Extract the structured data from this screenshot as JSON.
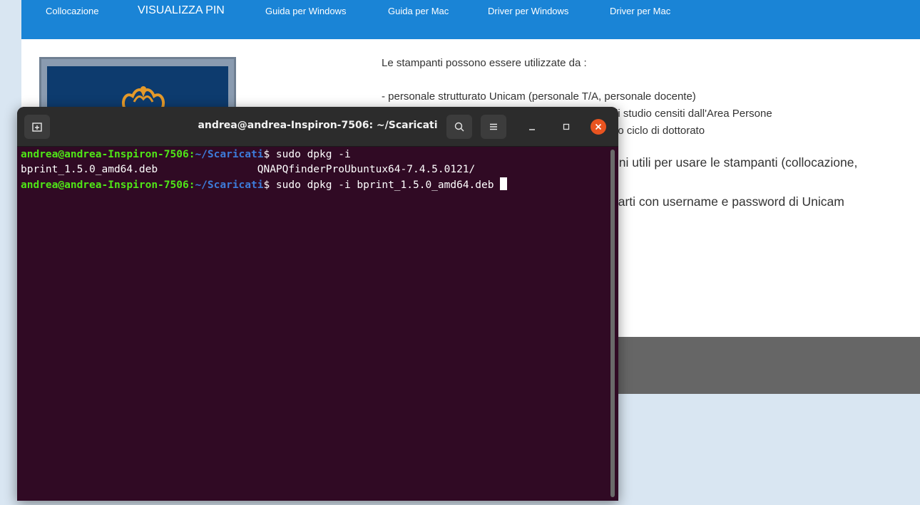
{
  "nav": {
    "items": [
      "Collocazione",
      "VISUALIZZA PIN",
      "Guida per Windows",
      "Guida per Mac",
      "Driver per Windows",
      "Driver per Mac"
    ]
  },
  "content": {
    "line1": "Le stampanti possono essere utilizzate da :",
    "line2": "- personale strutturato Unicam (personale T/A, personale docente)",
    "line3": "di studio censiti dall'Area Persone",
    "line4": "rio ciclo di dottorato",
    "line5": "oni utili per usare le stampanti (collocazione,",
    "line6": "carti con username e password di Unicam"
  },
  "terminal": {
    "title": "andrea@andrea-Inspiron-7506: ~/Scaricati",
    "lines": [
      {
        "user": "andrea@andrea-Inspiron-7506",
        "sep": ":",
        "path": "~/Scaricati",
        "cmd": "$ sudo dpkg -i"
      },
      {
        "output": "bprint_1.5.0_amd64.deb                QNAPQfinderProUbuntux64-7.4.5.0121/"
      },
      {
        "user": "andrea@andrea-Inspiron-7506",
        "sep": ":",
        "path": "~/Scaricati",
        "cmd": "$ sudo dpkg -i bprint_1.5.0_amd64.deb "
      }
    ]
  },
  "icons": {
    "new_tab": "new-tab-icon",
    "search": "search-icon",
    "menu": "hamburger-menu-icon",
    "minimize": "minimize-icon",
    "maximize": "maximize-icon",
    "close": "close-icon"
  },
  "colors": {
    "nav_blue": "#1a84d6",
    "terminal_bg": "#300a24",
    "prompt_user": "#4fe617",
    "prompt_path": "#3d7bd9",
    "close_orange": "#e95420"
  }
}
